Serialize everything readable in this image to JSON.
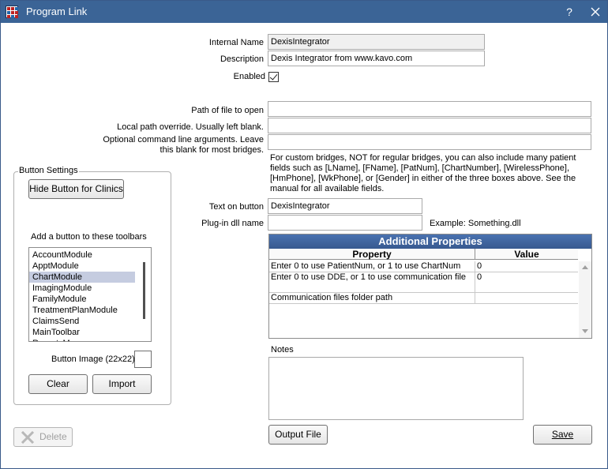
{
  "window": {
    "title": "Program Link",
    "help_label": "?",
    "close_label": "✕"
  },
  "form": {
    "internal_name_label": "Internal Name",
    "internal_name_value": "DexisIntegrator",
    "description_label": "Description",
    "description_value": "Dexis Integrator from www.kavo.com",
    "enabled_label": "Enabled",
    "enabled": true,
    "path_label": "Path of file to open",
    "path_value": "",
    "local_path_label": "Local path override.  Usually left blank.",
    "local_path_value": "",
    "cmd_args_label": "Optional command line arguments.  Leave this blank for most bridges.",
    "cmd_args_value": "",
    "custom_bridge_note": "For custom bridges, NOT for regular bridges, you can also include many patient fields such as [LName], [FName], [PatNum], [ChartNumber], [WirelessPhone], [HmPhone], [WkPhone], or [Gender] in either of the three boxes above. See the manual for all available fields.",
    "text_on_button_label": "Text on button",
    "text_on_button_value": "DexisIntegrator",
    "plugin_dll_label": "Plug-in dll name",
    "plugin_dll_value": "",
    "plugin_example": "Example: Something.dll"
  },
  "button_settings": {
    "group_title": "Button Settings",
    "hide_button_label": "Hide Button for Clinics",
    "toolbars_label": "Add a button to these toolbars",
    "toolbars": [
      "AccountModule",
      "ApptModule",
      "ChartModule",
      "ImagingModule",
      "FamilyModule",
      "TreatmentPlanModule",
      "ClaimsSend",
      "MainToolbar",
      "ReportsMenu"
    ],
    "selected_toolbar": "ChartModule",
    "button_image_label": "Button Image (22x22)",
    "clear_label": "Clear",
    "import_label": "Import"
  },
  "additional_properties": {
    "title": "Additional Properties",
    "property_header": "Property",
    "value_header": "Value",
    "rows": [
      {
        "property": "Enter 0 to use PatientNum, or 1 to use ChartNum",
        "value": "0"
      },
      {
        "property": "Enter 0 to use DDE, or 1 to use communication file",
        "value": "0"
      },
      {
        "property": "Communication files folder path",
        "value": ""
      }
    ]
  },
  "notes": {
    "label": "Notes",
    "value": ""
  },
  "footer": {
    "delete_label": "Delete",
    "output_file_label": "Output File",
    "save_label": "Save"
  },
  "colors": {
    "titlebar": "#3b6496",
    "grid_title": "#4a72b0",
    "selected_row": "#c5cce0"
  }
}
